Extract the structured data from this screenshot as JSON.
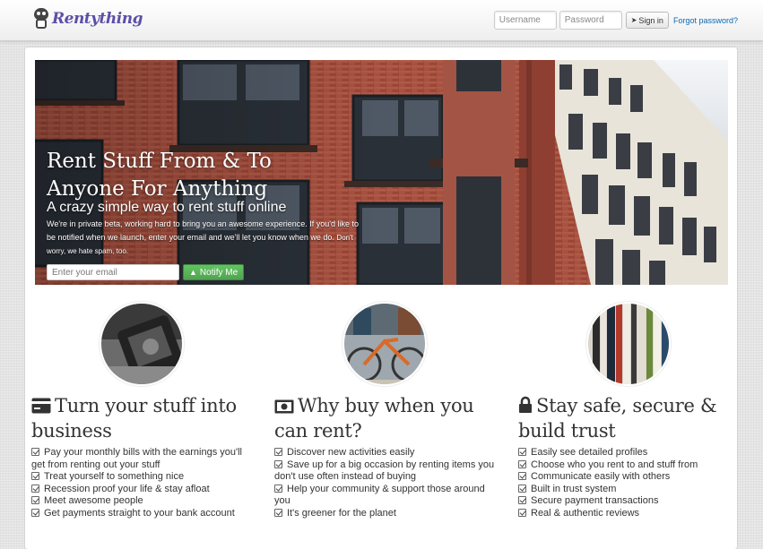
{
  "brand": {
    "name": "Rentything"
  },
  "login": {
    "username_placeholder": "Username",
    "password_placeholder": "Password",
    "signin_label": "Sign in",
    "forgot_label": "Forgot password?"
  },
  "hero": {
    "title_line1": "Rent Stuff From & To",
    "title_line2": "Anyone For Anything",
    "subtitle": "A crazy simple way to rent stuff online",
    "blurb": "We're in private beta, working hard to bring you an awesome experience. If you'd like to be notified when we launch, enter your email and we'll let you know when we do.",
    "blurb_small": "Don't worry, we hate spam, too.",
    "email_placeholder": "Enter your email",
    "notify_label": "Notify Me"
  },
  "features": [
    {
      "icon": "credit-card-icon",
      "title": "Turn your stuff into business",
      "items": [
        "Pay your monthly bills with the earnings you'll get from renting out your stuff",
        "Treat yourself to something nice",
        "Recession proof your life & stay afloat",
        "Meet awesome people",
        "Get payments straight to your bank account"
      ]
    },
    {
      "icon": "money-icon",
      "title": "Why buy when you can rent?",
      "items": [
        "Discover new activities easily",
        "Save up for a big occasion by renting items you don't use often instead of buying",
        "Help your community & support those around you",
        "It's greener for the planet"
      ]
    },
    {
      "icon": "lock-icon",
      "title": "Stay safe, secure & build trust",
      "items": [
        "Easily see detailed profiles",
        "Choose who you rent to and stuff from",
        "Communicate easily with others",
        "Built in trust system",
        "Secure payment transactions",
        "Real & authentic reviews"
      ]
    }
  ]
}
